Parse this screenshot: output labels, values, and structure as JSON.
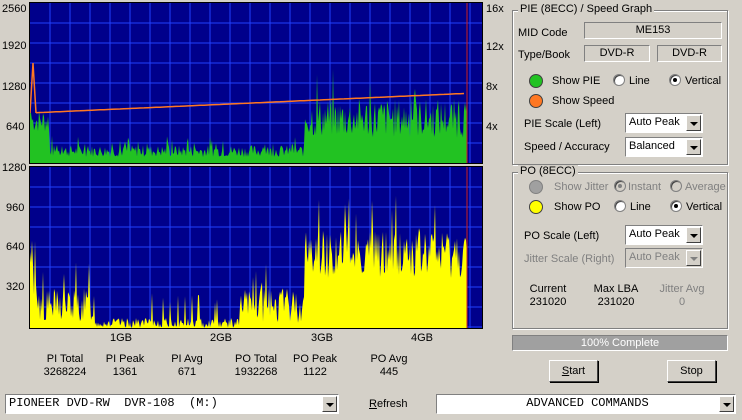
{
  "pie_graph": {
    "left_axis": [
      "2560",
      "1920",
      "1280",
      "640"
    ],
    "right_axis": [
      "16x",
      "12x",
      "8x",
      "4x"
    ]
  },
  "po_graph": {
    "left_axis": [
      "1280",
      "960",
      "640",
      "320"
    ],
    "x_labels": [
      "1GB",
      "2GB",
      "3GB",
      "4GB"
    ]
  },
  "stats": {
    "pi_total_label": "PI Total",
    "pi_total": "3268224",
    "pi_peak_label": "PI Peak",
    "pi_peak": "1361",
    "pi_avg_label": "PI Avg",
    "pi_avg": "671",
    "po_total_label": "PO Total",
    "po_total": "1932268",
    "po_peak_label": "PO Peak",
    "po_peak": "1122",
    "po_avg_label": "PO Avg",
    "po_avg": "445"
  },
  "pie_panel": {
    "title": "PIE (8ECC) / Speed Graph",
    "mid_label": "MID Code",
    "mid_value": "ME153",
    "type_label": "Type/Book",
    "type_value": "DVD-R",
    "book_value": "DVD-R",
    "show_pie": "Show PIE",
    "line": "Line",
    "vertical": "Vertical",
    "show_speed": "Show Speed",
    "pie_scale_label": "PIE Scale (Left)",
    "pie_scale_value": "Auto Peak",
    "speed_label": "Speed / Accuracy",
    "speed_value": "Balanced",
    "pie_color": "#22c222",
    "speed_color": "#ff7722"
  },
  "po_panel": {
    "title": "PO (8ECC)",
    "show_jitter": "Show Jitter",
    "instant": "Instant",
    "average": "Average",
    "show_po": "Show PO",
    "line": "Line",
    "vertical": "Vertical",
    "po_scale_label": "PO Scale (Left)",
    "po_scale_value": "Auto Peak",
    "jitter_scale_label": "Jitter Scale (Right)",
    "jitter_scale_value": "Auto Peak",
    "current_label": "Current",
    "current_value": "231020",
    "maxlba_label": "Max LBA",
    "maxlba_value": "231020",
    "jitter_avg_label": "Jitter Avg",
    "jitter_avg_value": "0",
    "po_color": "#ffff00"
  },
  "progress": {
    "text": "100% Complete",
    "fraction": 1.0
  },
  "buttons": {
    "start": "Start",
    "stop": "Stop"
  },
  "bottom": {
    "drive": "PIONEER DVD-RW  DVR-108  (M:)",
    "refresh": "Refresh",
    "advanced": "ADVANCED COMMANDS"
  }
}
